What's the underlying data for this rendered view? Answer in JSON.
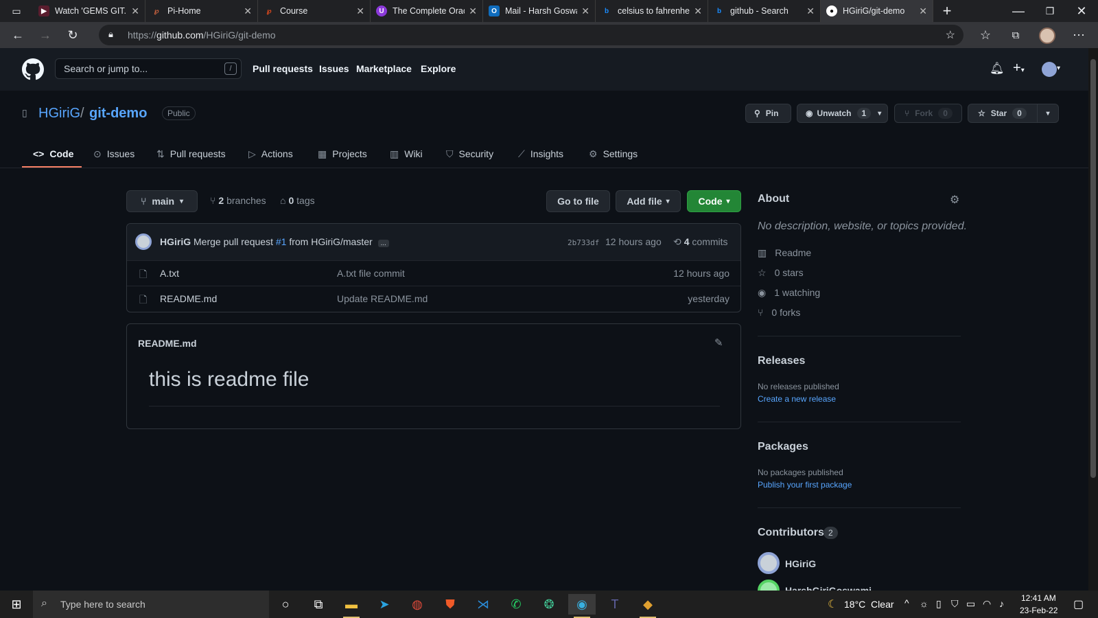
{
  "browser": {
    "tabs": [
      {
        "label": "Watch 'GEMS GIT...",
        "color": "#a3264a",
        "glyph": "▶"
      },
      {
        "label": "Pi-Home",
        "color": "#c8623f",
        "glyph": "℘"
      },
      {
        "label": "Course",
        "color": "#e24a1d",
        "glyph": "℘"
      },
      {
        "label": "The Complete Orac",
        "color": "#8b39d9",
        "glyph": "U"
      },
      {
        "label": "Mail - Harsh Goswa",
        "color": "#0f6cbd",
        "glyph": "O"
      },
      {
        "label": "celsius to fahrenhe",
        "color": "#1a73e8",
        "glyph": "b"
      },
      {
        "label": "github - Search",
        "color": "#1a73e8",
        "glyph": "b"
      },
      {
        "label": "HGiriG/git-demo",
        "color": "#ffffff",
        "glyph": "●"
      }
    ],
    "url_prefix": "https://",
    "url_host": "github.com",
    "url_path": "/HGiriG/git-demo"
  },
  "gh": {
    "search_placeholder": "Search or jump to...",
    "slash": "/",
    "nav": [
      "Pull requests",
      "Issues",
      "Marketplace",
      "Explore"
    ]
  },
  "repo": {
    "owner": "HGiriG",
    "sep": "/",
    "name": "git-demo",
    "visibility": "Public",
    "pin": "Pin",
    "unwatch": "Unwatch",
    "watch_count": "1",
    "fork": "Fork",
    "fork_count": "0",
    "star": "Star",
    "star_count": "0",
    "tabs": [
      "Code",
      "Issues",
      "Pull requests",
      "Actions",
      "Projects",
      "Wiki",
      "Security",
      "Insights",
      "Settings"
    ]
  },
  "main": {
    "branch": "main",
    "branches_count": "2",
    "branches_label": "branches",
    "tags_count": "0",
    "tags_label": "tags",
    "go_to_file": "Go to file",
    "add_file": "Add file",
    "code": "Code",
    "commit": {
      "author": "HGiriG",
      "msg_prefix": "Merge pull request",
      "pr": "#1",
      "msg_suffix": "from HGiriG/master",
      "ellipsis": "...",
      "sha": "2b733df",
      "time": "12 hours ago",
      "commits_count": "4",
      "commits_label": "commits"
    },
    "files": [
      {
        "name": "A.txt",
        "message": "A.txt file commit",
        "time": "12 hours ago"
      },
      {
        "name": "README.md",
        "message": "Update README.md",
        "time": "yesterday"
      }
    ],
    "readme_title": "README.md",
    "readme_heading": "this is readme file"
  },
  "sidebar": {
    "about": "About",
    "about_desc": "No description, website, or topics provided.",
    "readme": "Readme",
    "stars": "0 stars",
    "watching": "1 watching",
    "forks": "0 forks",
    "releases": "Releases",
    "no_releases": "No releases published",
    "create_release": "Create a new release",
    "packages": "Packages",
    "no_packages": "No packages published",
    "publish_package": "Publish your first package",
    "contributors": "Contributors",
    "contributors_count": "2",
    "contributor1": "HGiriG",
    "contributor2": "HarshGiriGoswami"
  },
  "taskbar": {
    "search_placeholder": "Type here to search",
    "weather": "18°C  Clear",
    "time": "12:41 AM",
    "date": "23-Feb-22"
  }
}
